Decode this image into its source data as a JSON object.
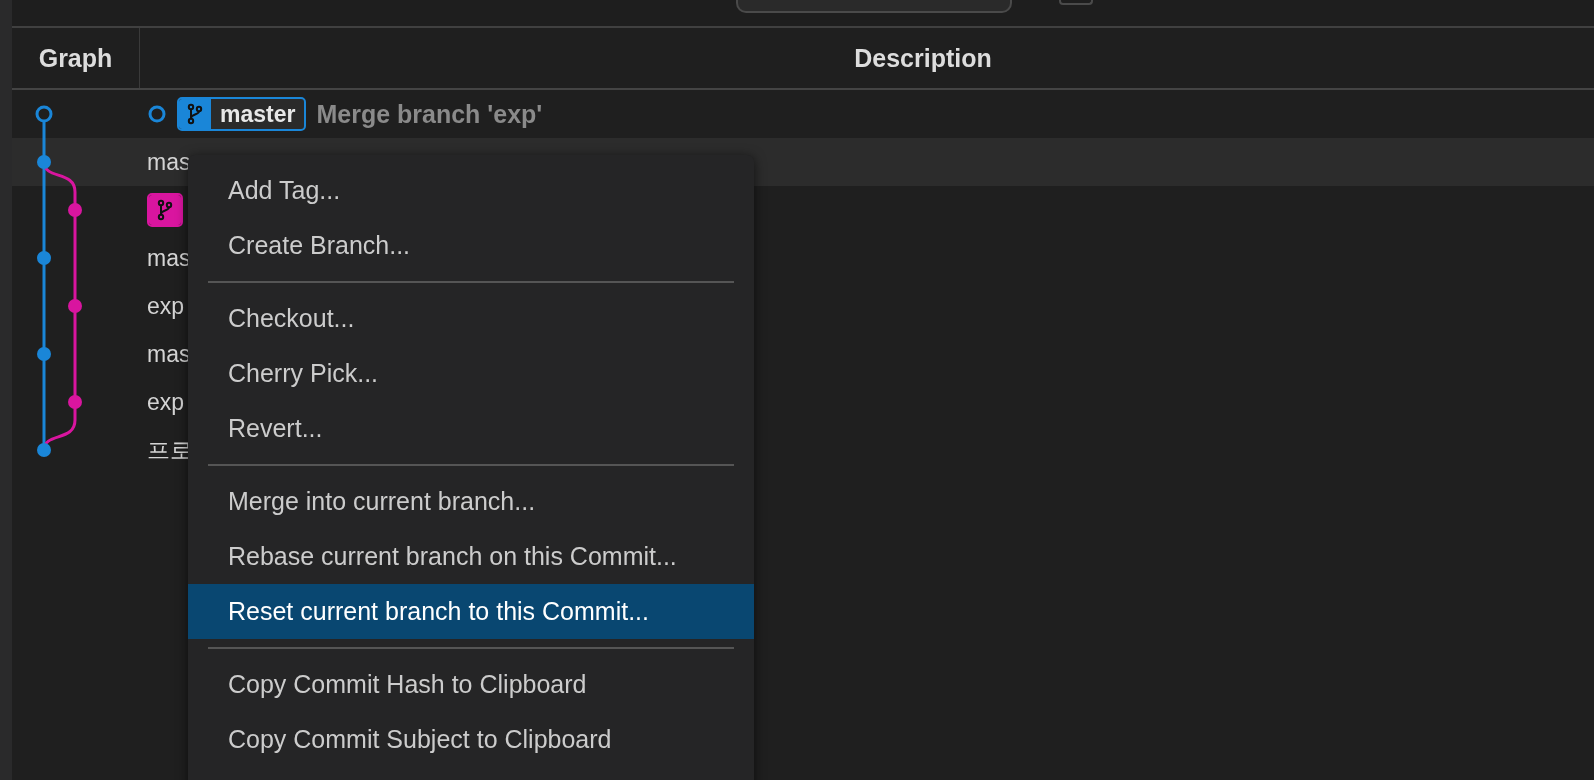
{
  "table": {
    "columns": [
      "Graph",
      "Description"
    ],
    "lanes": [
      {
        "kind": "main",
        "color": "#1a86d8"
      },
      {
        "kind": "side",
        "color": "#d9159f"
      }
    ],
    "rows": [
      {
        "kind": "main",
        "head": true,
        "selected": false,
        "branch": {
          "label": "master",
          "color": "#1a86d8"
        },
        "description": "Merge branch 'exp'"
      },
      {
        "kind": "main",
        "head": false,
        "selected": true,
        "description": "mas"
      },
      {
        "kind": "side",
        "head": false,
        "selected": false,
        "branch": {
          "color": "#d9159f"
        }
      },
      {
        "kind": "main",
        "head": false,
        "selected": false,
        "description": "mas"
      },
      {
        "kind": "side",
        "head": false,
        "selected": false,
        "description": "exp"
      },
      {
        "kind": "main",
        "head": false,
        "selected": false,
        "description": "mas"
      },
      {
        "kind": "side",
        "head": false,
        "selected": false,
        "description": "exp"
      },
      {
        "kind": "main",
        "head": false,
        "selected": false,
        "description": "프로"
      }
    ]
  },
  "context_menu": {
    "items": [
      {
        "kind": "item",
        "label": "Add Tag...",
        "selected": false
      },
      {
        "kind": "item",
        "label": "Create Branch...",
        "selected": false
      },
      {
        "kind": "separator"
      },
      {
        "kind": "item",
        "label": "Checkout...",
        "selected": false
      },
      {
        "kind": "item",
        "label": "Cherry Pick...",
        "selected": false
      },
      {
        "kind": "item",
        "label": "Revert...",
        "selected": false
      },
      {
        "kind": "separator"
      },
      {
        "kind": "item",
        "label": "Merge into current branch...",
        "selected": false
      },
      {
        "kind": "item",
        "label": "Rebase current branch on this Commit...",
        "selected": false
      },
      {
        "kind": "item",
        "label": "Reset current branch to this Commit...",
        "selected": true
      },
      {
        "kind": "separator"
      },
      {
        "kind": "item",
        "label": "Copy Commit Hash to Clipboard",
        "selected": false
      },
      {
        "kind": "item",
        "label": "Copy Commit Subject to Clipboard",
        "selected": false
      }
    ]
  }
}
